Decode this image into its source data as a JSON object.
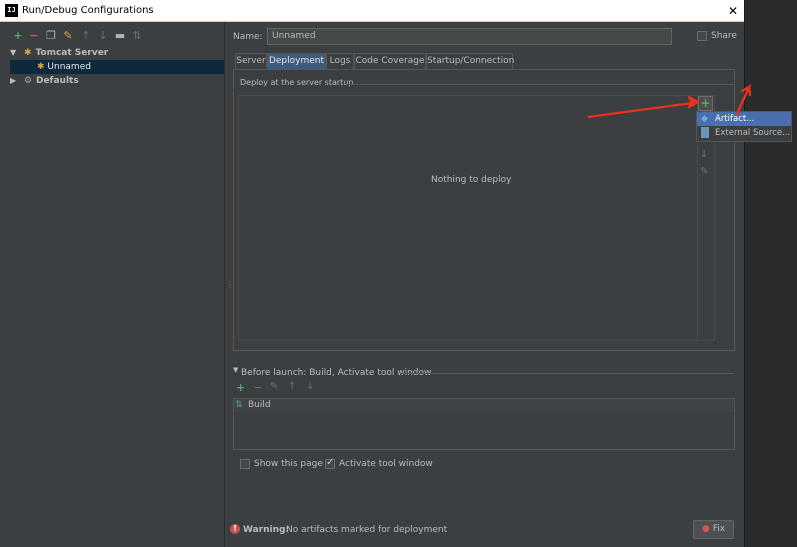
{
  "window": {
    "title": "Run/Debug Configurations",
    "app_icon": "IJ"
  },
  "toolbar": {
    "icons": [
      {
        "name": "add-icon",
        "glyph": "+",
        "color": "#59a869"
      },
      {
        "name": "remove-icon",
        "glyph": "−",
        "color": "#c75450"
      },
      {
        "name": "copy-icon",
        "glyph": "❐",
        "color": "#afb1b3"
      },
      {
        "name": "edit-defaults-icon",
        "glyph": "✎",
        "color": "#d9a343"
      },
      {
        "name": "move-up-icon",
        "glyph": "↑",
        "color": "#6e6e6e"
      },
      {
        "name": "move-down-icon",
        "glyph": "↓",
        "color": "#6e6e6e"
      },
      {
        "name": "folder-icon",
        "glyph": "▬",
        "color": "#afb1b3"
      },
      {
        "name": "sort-icon",
        "glyph": "⇅",
        "color": "#6e6e6e"
      }
    ]
  },
  "tree": {
    "group_label": "Tomcat Server",
    "child_label": "Unnamed",
    "defaults_label": "Defaults"
  },
  "form": {
    "name_label": "Name:",
    "name_value": "Unnamed",
    "share_label": "Share"
  },
  "tabs": [
    "Server",
    "Deployment",
    "Logs",
    "Code Coverage",
    "Startup/Connection"
  ],
  "deployment": {
    "section_label": "Deploy at the server startup",
    "empty_text": "Nothing to deploy"
  },
  "popup": {
    "items": [
      "Artifact...",
      "External Source..."
    ]
  },
  "before_launch": {
    "header": "Before launch: Build, Activate tool window",
    "item": "Build"
  },
  "options": {
    "show_page": "Show this page",
    "activate_tool_window": "Activate tool window"
  },
  "warning": {
    "label": "Warning:",
    "text": "No artifacts marked for deployment"
  },
  "fix_button": "Fix",
  "colors": {
    "accent_selection": "#4b6eaf",
    "tab_selected": "#3d5c80",
    "tree_selected": "#0d293e",
    "arrow_red": "#e8321e",
    "add_green": "#59a869"
  }
}
